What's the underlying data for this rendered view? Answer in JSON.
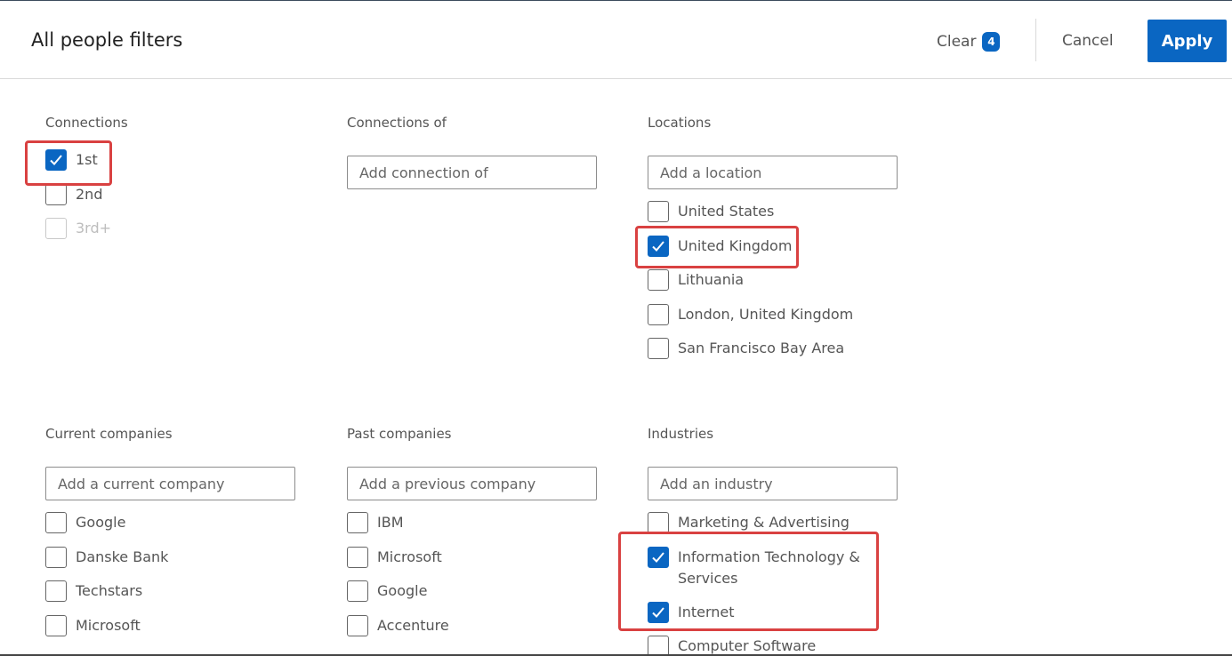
{
  "header": {
    "title": "All people filters",
    "clear_label": "Clear",
    "clear_count": "4",
    "cancel_label": "Cancel",
    "apply_label": "Apply"
  },
  "sections": {
    "connections": {
      "label": "Connections",
      "options": [
        {
          "label": "1st",
          "checked": true
        },
        {
          "label": "2nd",
          "checked": false
        },
        {
          "label": "3rd+",
          "checked": false,
          "disabled": true
        }
      ]
    },
    "connections_of": {
      "label": "Connections of",
      "placeholder": "Add connection of"
    },
    "locations": {
      "label": "Locations",
      "placeholder": "Add a location",
      "options": [
        {
          "label": "United States",
          "checked": false
        },
        {
          "label": "United Kingdom",
          "checked": true
        },
        {
          "label": "Lithuania",
          "checked": false
        },
        {
          "label": "London, United Kingdom",
          "checked": false
        },
        {
          "label": "San Francisco Bay Area",
          "checked": false
        }
      ]
    },
    "current_companies": {
      "label": "Current companies",
      "placeholder": "Add a current company",
      "options": [
        {
          "label": "Google",
          "checked": false
        },
        {
          "label": "Danske Bank",
          "checked": false
        },
        {
          "label": "Techstars",
          "checked": false
        },
        {
          "label": "Microsoft",
          "checked": false
        }
      ]
    },
    "past_companies": {
      "label": "Past companies",
      "placeholder": "Add a previous company",
      "options": [
        {
          "label": "IBM",
          "checked": false
        },
        {
          "label": "Microsoft",
          "checked": false
        },
        {
          "label": "Google",
          "checked": false
        },
        {
          "label": "Accenture",
          "checked": false
        }
      ]
    },
    "industries": {
      "label": "Industries",
      "placeholder": "Add an industry",
      "options": [
        {
          "label": "Marketing & Advertising",
          "checked": false
        },
        {
          "label": "Information Technology & Services",
          "checked": true
        },
        {
          "label": "Internet",
          "checked": true
        },
        {
          "label": "Computer Software",
          "checked": false
        }
      ]
    }
  },
  "colors": {
    "accent": "#0a66c2",
    "highlight": "#d94141"
  },
  "icons": {
    "checkmark": "check-icon"
  }
}
